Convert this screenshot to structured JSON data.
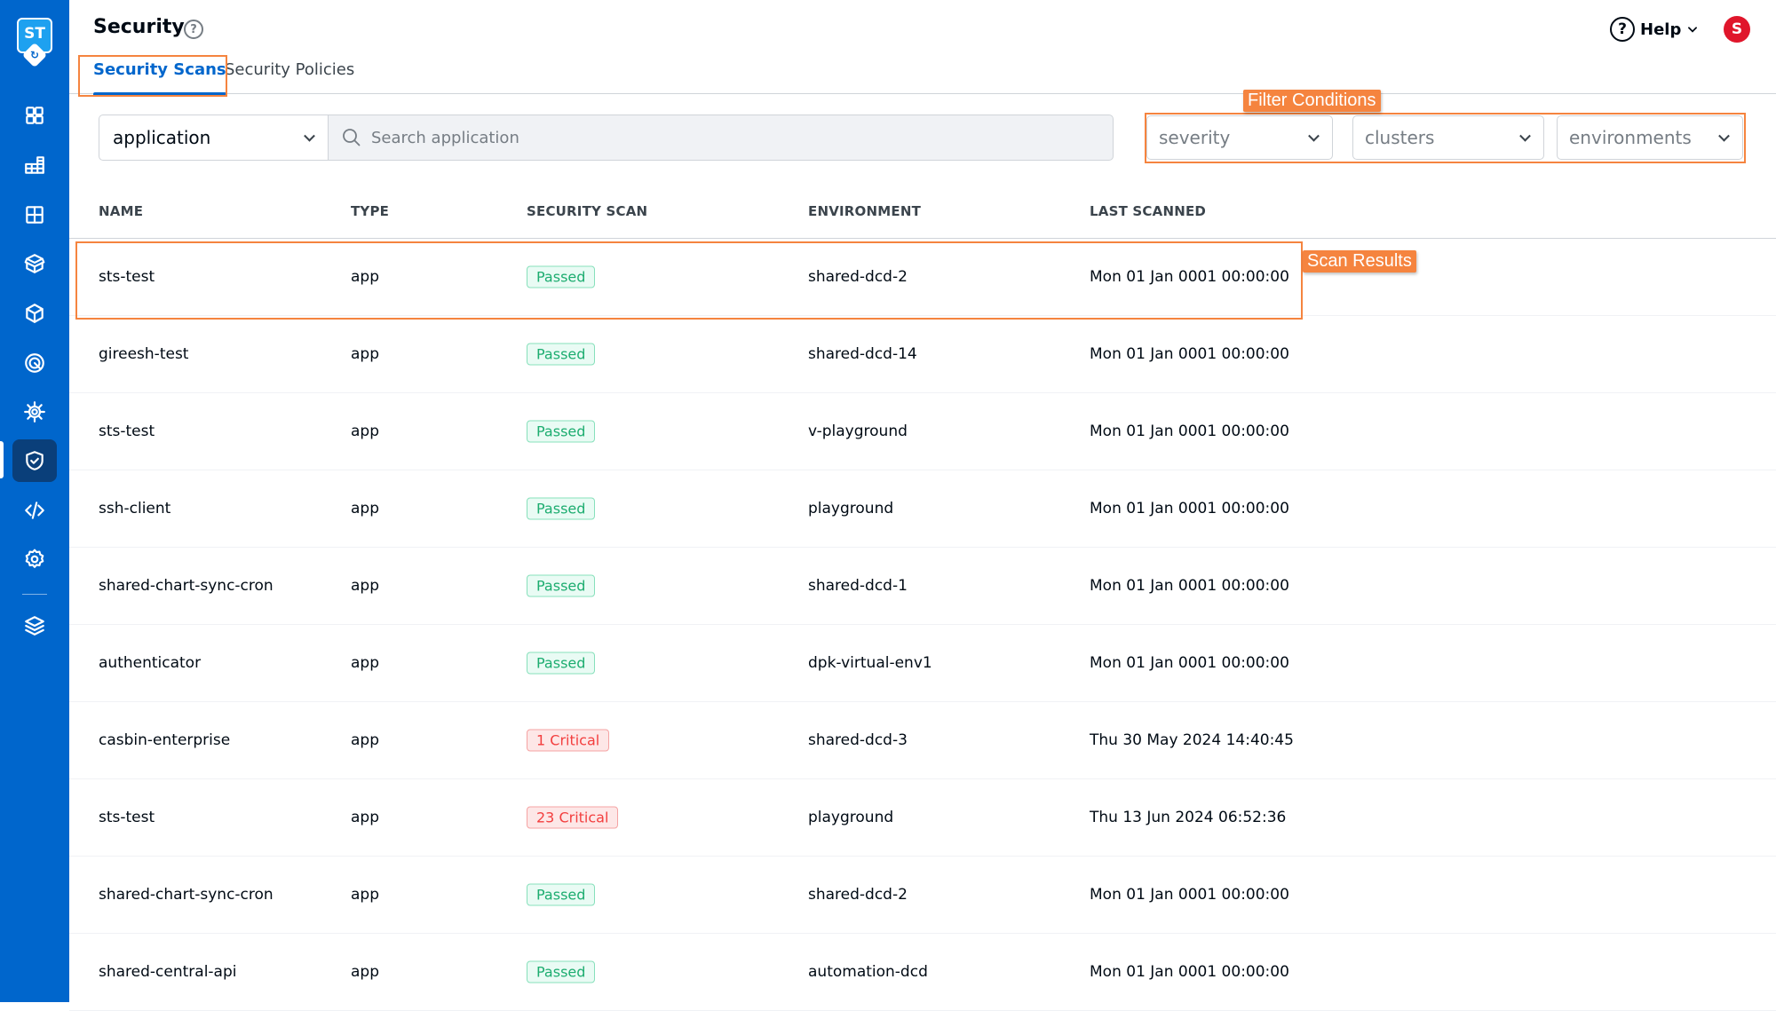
{
  "sidebar": {
    "logo_text": "ST",
    "logo_badge": "↻",
    "items": [
      {
        "name": "applications",
        "icon": "grid-four-icon"
      },
      {
        "name": "application-groups",
        "icon": "grid-stack-icon"
      },
      {
        "name": "resource-browser",
        "icon": "grid-square-icon"
      },
      {
        "name": "charts",
        "icon": "open-box-icon"
      },
      {
        "name": "deployment-groups",
        "icon": "cube-icon"
      },
      {
        "name": "bulk-edit",
        "icon": "target-icon"
      },
      {
        "name": "global-configurations",
        "icon": "helm-wheel-icon"
      },
      {
        "name": "security",
        "icon": "shield-check-icon",
        "active": true
      },
      {
        "name": "code",
        "icon": "code-icon"
      },
      {
        "name": "settings",
        "icon": "gear-icon"
      },
      {
        "name": "stack-manager",
        "icon": "layers-icon"
      }
    ]
  },
  "header": {
    "title": "Security",
    "help_label": "Help",
    "avatar_initial": "S"
  },
  "tabs": [
    {
      "label": "Security Scans",
      "active": true
    },
    {
      "label": "Security Policies",
      "active": false
    }
  ],
  "toolbar": {
    "search_type": "application",
    "search_placeholder": "Search application",
    "search_value": "",
    "filters": [
      {
        "label": "severity"
      },
      {
        "label": "clusters"
      },
      {
        "label": "environments"
      }
    ]
  },
  "annotations": {
    "filter_conditions": "Filter Conditions",
    "scan_results": "Scan Results"
  },
  "table": {
    "columns": [
      "NAME",
      "TYPE",
      "SECURITY SCAN",
      "ENVIRONMENT",
      "LAST SCANNED"
    ],
    "rows": [
      {
        "name": "sts-test",
        "type": "app",
        "scan": "Passed",
        "scan_status": "passed",
        "environment": "shared-dcd-2",
        "last_scanned": "Mon 01 Jan 0001 00:00:00"
      },
      {
        "name": "gireesh-test",
        "type": "app",
        "scan": "Passed",
        "scan_status": "passed",
        "environment": "shared-dcd-14",
        "last_scanned": "Mon 01 Jan 0001 00:00:00"
      },
      {
        "name": "sts-test",
        "type": "app",
        "scan": "Passed",
        "scan_status": "passed",
        "environment": "v-playground",
        "last_scanned": "Mon 01 Jan 0001 00:00:00"
      },
      {
        "name": "ssh-client",
        "type": "app",
        "scan": "Passed",
        "scan_status": "passed",
        "environment": "playground",
        "last_scanned": "Mon 01 Jan 0001 00:00:00"
      },
      {
        "name": "shared-chart-sync-cron",
        "type": "app",
        "scan": "Passed",
        "scan_status": "passed",
        "environment": "shared-dcd-1",
        "last_scanned": "Mon 01 Jan 0001 00:00:00"
      },
      {
        "name": "authenticator",
        "type": "app",
        "scan": "Passed",
        "scan_status": "passed",
        "environment": "dpk-virtual-env1",
        "last_scanned": "Mon 01 Jan 0001 00:00:00"
      },
      {
        "name": "casbin-enterprise",
        "type": "app",
        "scan": "1 Critical",
        "scan_status": "critical",
        "environment": "shared-dcd-3",
        "last_scanned": "Thu 30 May 2024 14:40:45"
      },
      {
        "name": "sts-test",
        "type": "app",
        "scan": "23 Critical",
        "scan_status": "critical",
        "environment": "playground",
        "last_scanned": "Thu 13 Jun 2024 06:52:36"
      },
      {
        "name": "shared-chart-sync-cron",
        "type": "app",
        "scan": "Passed",
        "scan_status": "passed",
        "environment": "shared-dcd-2",
        "last_scanned": "Mon 01 Jan 0001 00:00:00"
      },
      {
        "name": "shared-central-api",
        "type": "app",
        "scan": "Passed",
        "scan_status": "passed",
        "environment": "automation-dcd",
        "last_scanned": "Mon 01 Jan 0001 00:00:00"
      }
    ]
  },
  "colors": {
    "brand": "#0066cc",
    "annotation": "#f5843f",
    "passed": "#1dad70",
    "critical": "#f33e3e",
    "avatar": "#e0162b"
  }
}
